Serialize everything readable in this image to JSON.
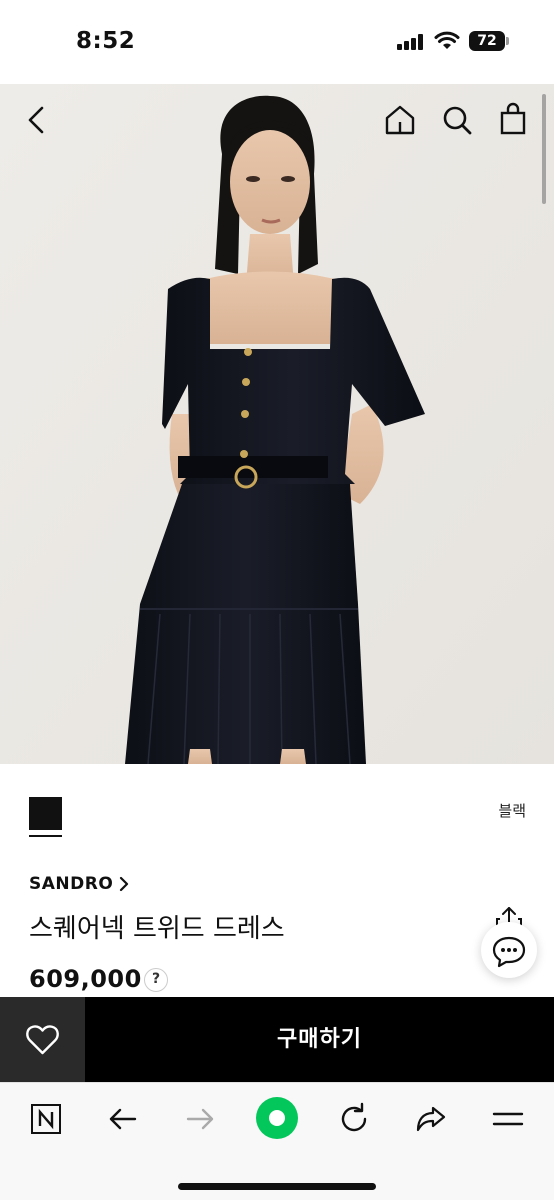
{
  "status_bar": {
    "time": "8:52",
    "battery": "72"
  },
  "top_nav": {
    "icons": [
      "chevron-left-icon",
      "home-icon",
      "search-icon",
      "shopping-bag-icon"
    ]
  },
  "product": {
    "color_swatch": "#111111",
    "color_name": "블랙",
    "brand": "SANDRO",
    "name": "스퀘어넥 트위드 드레스",
    "price": "609,000",
    "help_label": "?"
  },
  "purchase_bar": {
    "buy_label": "구매하기",
    "wish_icon": "heart-outline-icon"
  },
  "browser_toolbar": {
    "icons": [
      "naver-n-icon",
      "arrow-left-icon",
      "arrow-right-icon",
      "green-circle-icon",
      "refresh-icon",
      "share-arrow-icon",
      "menu-icon"
    ]
  },
  "colors": {
    "accent_green": "#03c75a",
    "buy_button": "#000000",
    "wish_button": "#2a2a2a"
  }
}
